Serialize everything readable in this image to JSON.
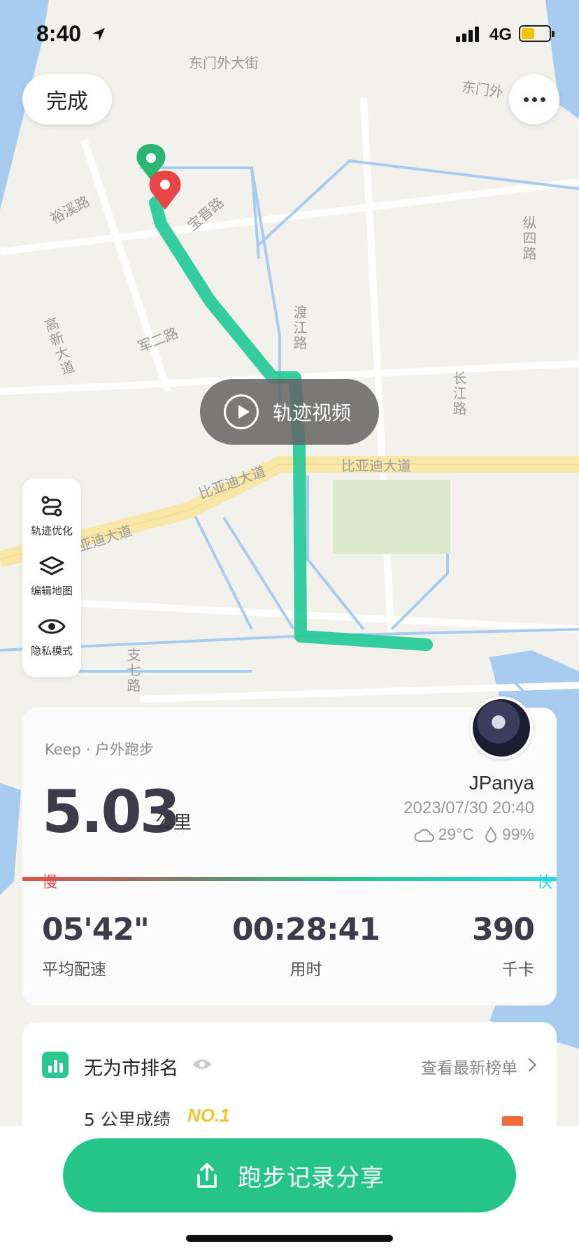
{
  "status_bar": {
    "time": "8:40",
    "network": "4G"
  },
  "map": {
    "road_labels": {
      "dongmen_1": "东门外大街",
      "dongmen_2": "东门外",
      "yuxi": "裕溪路",
      "baojin": "宝晋路",
      "zongsi": "纵四路",
      "gaoxin": "高新大道",
      "juner": "军二路",
      "dujiang": "渡江路",
      "changjiang": "长江路",
      "byd_1": "比亚迪大道",
      "byd_2": "比亚迪大道",
      "byd_3": "亚迪大道",
      "zhiqi": "支七路"
    },
    "colors": {
      "route": "#1fc996",
      "start_pin": "#2bb673",
      "end_pin": "#e84545",
      "water": "#a8ccf0",
      "main_road": "#f8e7a6"
    }
  },
  "toolbar": {
    "done_label": "完成",
    "video_label": "轨迹视频"
  },
  "side_tools": [
    {
      "label": "轨迹优化",
      "icon": "route-icon"
    },
    {
      "label": "编辑地图",
      "icon": "layers-icon"
    },
    {
      "label": "隐私模式",
      "icon": "eye-icon"
    }
  ],
  "summary": {
    "source": "Keep · 户外跑步",
    "distance": "5.03",
    "distance_unit": "公里",
    "user_name": "JPanya",
    "datetime": "2023/07/30 20:40",
    "temperature": "29°C",
    "humidity": "99%",
    "pace_slow": "慢",
    "pace_fast": "快",
    "metrics": [
      {
        "value": "05'42\"",
        "label": "平均配速"
      },
      {
        "value": "00:28:41",
        "label": "用时"
      },
      {
        "value": "390",
        "label": "千卡"
      }
    ]
  },
  "ranking": {
    "title": "无为市排名",
    "link": "查看最新榜单",
    "subtitle": "5 公里成绩",
    "rank": "NO.1"
  },
  "share": {
    "label": "跑步记录分享"
  }
}
